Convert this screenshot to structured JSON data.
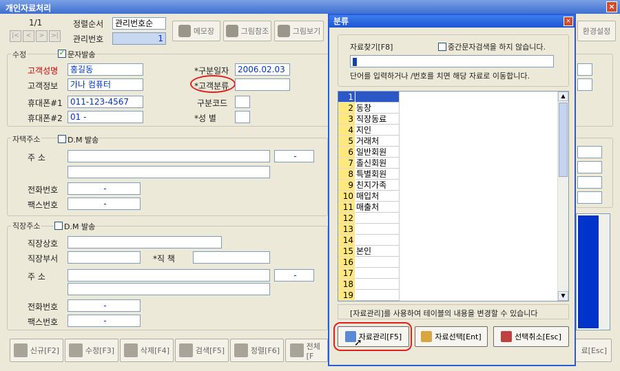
{
  "window": {
    "title": "개인자료처리"
  },
  "nav": {
    "record_pos": "1/1",
    "buttons": [
      "|<",
      "<",
      ">",
      ">|"
    ]
  },
  "sort": {
    "label": "정렬순서",
    "value": "관리번호순"
  },
  "mgmt": {
    "label": "관리번호",
    "value": "1"
  },
  "toolbar": {
    "memo": "메모장",
    "pic_ref": "그림참조",
    "pic_view": "그림보기",
    "env": "환경설정"
  },
  "edit_section": {
    "title": "수정",
    "sms_checkbox": "문자발송",
    "name_label": "고객성명",
    "name_value": "홍길동",
    "info_label": "고객정보",
    "info_value": "가나 컴퓨터",
    "mobile1_label": "휴대폰#1",
    "mobile1_value": "011-123-4567",
    "mobile2_label": "휴대폰#2",
    "mobile2_value": "01 -",
    "date_label": "*구분일자",
    "date_value": "2006.02.03",
    "class_label": "*고객분류",
    "code_label": "구분코드",
    "gender_label": "*성   별"
  },
  "home_section": {
    "title": "자택주소",
    "dm": "D.M 발송",
    "addr_label": "주   소",
    "dash": "-",
    "phone_label": "전화번호",
    "fax_label": "팩스번호"
  },
  "work_section": {
    "title": "직장주소",
    "dm": "D.M 발송",
    "company_label": "직장상호",
    "dept_label": "직장부서",
    "position_label": "*직   책",
    "addr_label": "주   소",
    "dash": "-",
    "phone_label": "전화번호",
    "fax_label": "팩스번호"
  },
  "bottom_buttons": [
    "신규[F2]",
    "수정[F3]",
    "삭제[F4]",
    "검색[F5]",
    "정렬[F6]",
    "전체[F",
    "료[Esc]"
  ],
  "dialog": {
    "title": "분류",
    "search_label": "자료찾기[F8]",
    "mid_search_checkbox": "중간문자검색을 하지 않습니다.",
    "hint": "단어를 입력하거나 /번호를 치면 해당 자료로 이동합니다.",
    "rows": [
      {
        "n": "1",
        "v": ""
      },
      {
        "n": "2",
        "v": "동창"
      },
      {
        "n": "3",
        "v": "직장동료"
      },
      {
        "n": "4",
        "v": "지인"
      },
      {
        "n": "5",
        "v": "거래처"
      },
      {
        "n": "6",
        "v": "일반회원"
      },
      {
        "n": "7",
        "v": "졸신회원"
      },
      {
        "n": "8",
        "v": "특별회원"
      },
      {
        "n": "9",
        "v": "친지가족"
      },
      {
        "n": "10",
        "v": "매입처"
      },
      {
        "n": "11",
        "v": "매출처"
      },
      {
        "n": "12",
        "v": ""
      },
      {
        "n": "13",
        "v": ""
      },
      {
        "n": "14",
        "v": ""
      },
      {
        "n": "15",
        "v": "본인"
      },
      {
        "n": "16",
        "v": ""
      },
      {
        "n": "17",
        "v": ""
      },
      {
        "n": "18",
        "v": ""
      },
      {
        "n": "19",
        "v": ""
      }
    ],
    "footer_note": "[자료관리]를 사용하여 테이블의 내용을 변경할 수 있습니다",
    "btn_manage": "자료관리[F5]",
    "btn_select": "자료선택[Ent]",
    "btn_cancel": "선택취소[Esc]"
  }
}
